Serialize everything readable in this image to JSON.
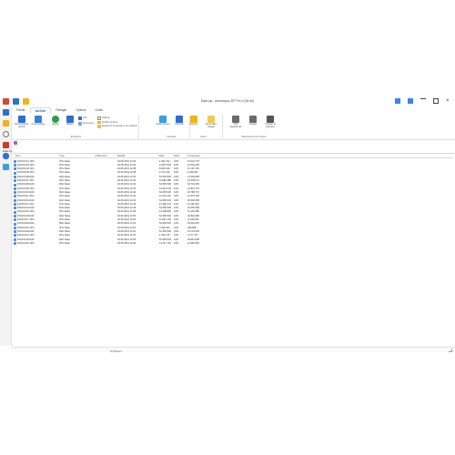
{
  "window": {
    "title": "Data.zip - Ashampoo ZIP Pro 4 (64 bit)"
  },
  "tabs": [
    {
      "label": "Fichier"
    },
    {
      "label": "Archive"
    },
    {
      "label": "Partager"
    },
    {
      "label": "Options"
    },
    {
      "label": "Guide"
    }
  ],
  "ribbon": {
    "groups": {
      "extraction": "Extraction",
      "nouvelle": "Nouvelle",
      "gerer": "Gérer",
      "selection": "Sélectionner les fichiers"
    },
    "buttons": {
      "extract_archive": "Décompresser archive",
      "open_archive": "Ouvrir archive",
      "add": "Ajouter",
      "delete": "Effacer",
      "info": "Info...",
      "rename": "Renommer...",
      "options": "Options...",
      "verify": "Vérifier l'archive",
      "remove_signature": "Supprimer la signature du certificat",
      "copy_windows": "Copier fichiers",
      "convert": "Convertir",
      "share": "Envoyer",
      "cloud": "Ouvrir dans Google",
      "select_all": "Tout sélectionner",
      "invert": "Inverser",
      "invert_selection": "Inverser la sélection"
    }
  },
  "breadcrumb": "Data.zip",
  "columns": [
    "Nom",
    "Type",
    "Chiffrement",
    "Modifié",
    "Taille",
    "Ratio",
    "Compressé"
  ],
  "rows": [
    [
      "DSCF1001.JPG",
      "JPG Datei",
      "",
      "02.05.2019 12:36",
      "1.993.722",
      "10%",
      "10.022.779"
    ],
    [
      "DSCF1003.JPG",
      "JPG Datei",
      "",
      "02.05.2019 12:36",
      "14.867.518",
      "10%",
      "10.003.030"
    ],
    [
      "DSCF1004.JPG",
      "JPG Datei",
      "",
      "02.05.2019 12:38",
      "8.843.138",
      "10%",
      "11.131.715"
    ],
    [
      "DSCF1005.JPG",
      "JPG Datei",
      "",
      "02.05.2019 12:38",
      "2.744.168",
      "10%",
      "2.298.294"
    ],
    [
      "DSCF1006.RAF",
      "RAF Datei",
      "",
      "02.05.2019 12:40",
      "52.355.536",
      "10%",
      "47.093.668"
    ],
    [
      "DSCF1007.JPG",
      "JPG Datei",
      "",
      "02.05.2019 12:40",
      "11.880.388",
      "10%",
      "10.693.071"
    ],
    [
      "DSCF1008.RAF",
      "RAF Datei",
      "",
      "02.05.2019 12:42",
      "52.355.536",
      "10%",
      "46.734.365"
    ],
    [
      "DSCF1009.JPG",
      "JPG Datei",
      "",
      "02.05.2019 12:42",
      "12.016.244",
      "10%",
      "10.813.715"
    ],
    [
      "DSCF1010.RAF",
      "RAF Datei",
      "",
      "02.05.2019 12:44",
      "52.355.536",
      "10%",
      "46.788.767"
    ],
    [
      "DSCF1011.JPG",
      "JPG Datei",
      "",
      "02.05.2019 12:44",
      "11.611.240",
      "10%",
      "10.675.160"
    ],
    [
      "DSCF1012.RAF",
      "RAF Datei",
      "",
      "02.05.2019 12:46",
      "52.355.536",
      "10%",
      "46.618.385"
    ],
    [
      "DSCF1013.JPG",
      "JPG Datei",
      "",
      "02.05.2019 12:46",
      "13.180.172",
      "10%",
      "11.262.907"
    ],
    [
      "DSCF1014.RAF",
      "RAF Datei",
      "",
      "02.05.2019 12:48",
      "52.355.536",
      "10%",
      "46.465.665"
    ],
    [
      "DSCF1015.JPG",
      "JPG Datei",
      "",
      "02.05.2019 12:48",
      "12.448.860",
      "10%",
      "11.204.380"
    ],
    [
      "DSCF1016.RAF",
      "RAF Datei",
      "",
      "02.05.2019 12:50",
      "52.355.536",
      "10%",
      "46.840.680"
    ],
    [
      "DSCF1017.JPG",
      "JPG Datei",
      "",
      "02.05.2019 12:50",
      "11.851.135",
      "10%",
      "11.646.511"
    ],
    [
      "DSCF1018.RAF",
      "RAF Datei",
      "",
      "02.05.2019 12:52",
      "52.355.536",
      "10%",
      "46.304.697"
    ],
    [
      "DSCF1019.JPG",
      "JPG Datei",
      "",
      "02.05.2019 12:52",
      "4.399.032",
      "10%",
      "298.988"
    ],
    [
      "DSCF1020.RAF",
      "RAF Datei",
      "",
      "02.05.2019 12:54",
      "52.355.536",
      "10%",
      "46.719.063"
    ],
    [
      "DSCF1021.JPG",
      "JPG Datei",
      "",
      "02.05.2019 12:54",
      "1.336.178",
      "10%",
      "1.177.757"
    ],
    [
      "DSCF1022.RAF",
      "RAF Datei",
      "",
      "02.05.2019 12:56",
      "52.355.536",
      "10%",
      "46.861.085"
    ],
    [
      "DSCF1023.JPG",
      "JPG Datei",
      "",
      "02.05.2019 12:56",
      "13.117.104",
      "10%",
      "11.805.393"
    ]
  ],
  "status": "22 fichiers",
  "colors": {
    "accent": "#1a5fb4",
    "ribbon_bg": "#ffffff",
    "sidebar_bg": "#f3f3f3"
  }
}
